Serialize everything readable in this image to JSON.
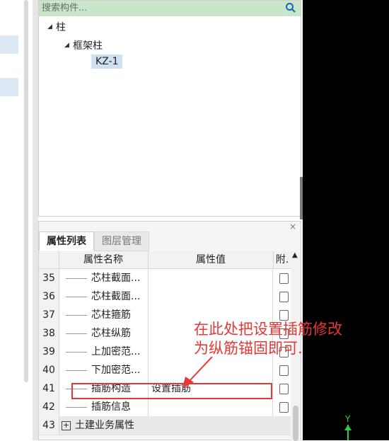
{
  "search": {
    "placeholder": "搜索构件..."
  },
  "tree": {
    "root": "柱",
    "child": "框架柱",
    "leaf": "KZ-1"
  },
  "panel": {
    "close": "×",
    "tabs": [
      "属性列表",
      "图层管理"
    ]
  },
  "columns": {
    "name": "属性名称",
    "value": "属性值",
    "extra": "附."
  },
  "rows": [
    {
      "num": "35",
      "name": "芯柱截面...",
      "value": ""
    },
    {
      "num": "36",
      "name": "芯柱截面...",
      "value": ""
    },
    {
      "num": "37",
      "name": "芯柱箍筋",
      "value": ""
    },
    {
      "num": "38",
      "name": "芯柱纵筋",
      "value": ""
    },
    {
      "num": "39",
      "name": "上加密范...",
      "value": ""
    },
    {
      "num": "40",
      "name": "下加密范...",
      "value": ""
    },
    {
      "num": "41",
      "name": "插筋构造",
      "value": "设置插筋"
    },
    {
      "num": "42",
      "name": "插筋信息",
      "value": ""
    }
  ],
  "group_row": {
    "num": "43",
    "name": "土建业务属性"
  },
  "annotation": {
    "line1": "在此处把设置插筋修改",
    "line2": "为纵筋锚固即可."
  },
  "axis_label": "Y",
  "colors": {
    "annotation": "#e53935",
    "search_bg": "#c8e6c9",
    "selection": "#cfe0f1"
  }
}
